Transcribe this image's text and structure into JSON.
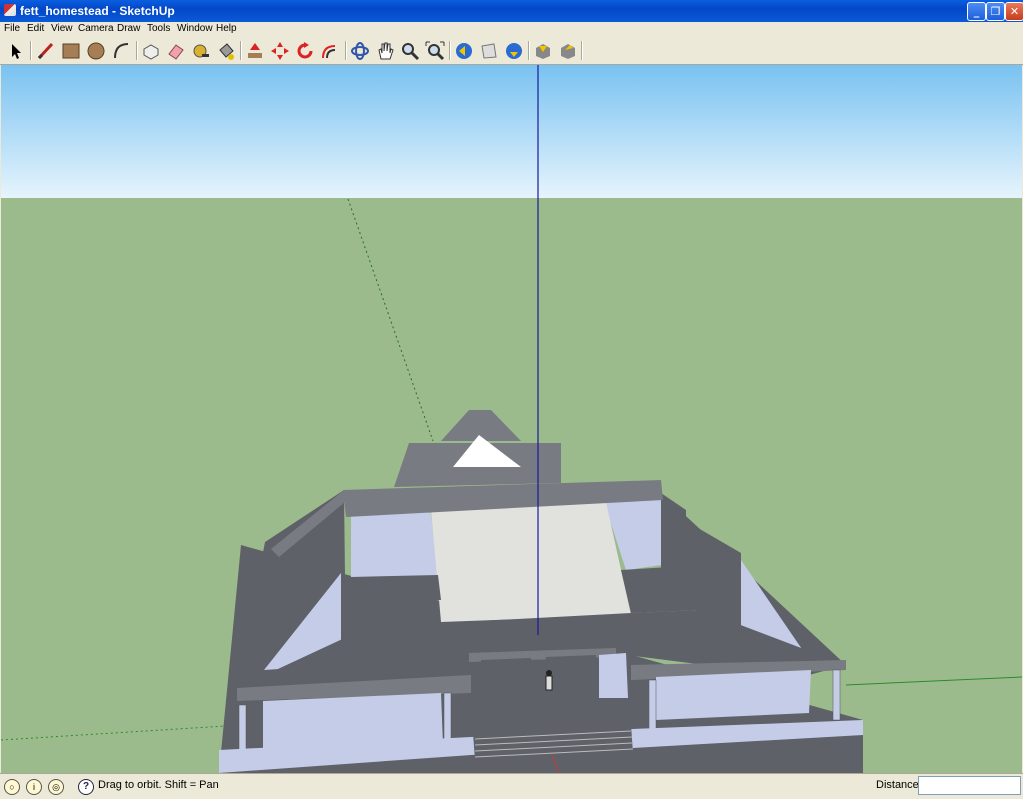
{
  "window": {
    "title": "fett_homestead - SketchUp",
    "buttons": {
      "minimize": "_",
      "maximize": "❐",
      "close": "✕"
    }
  },
  "menu": {
    "items": [
      "File",
      "Edit",
      "View",
      "Camera",
      "Draw",
      "Tools",
      "Window",
      "Help"
    ]
  },
  "toolbar": {
    "tools": [
      "select-tool-icon",
      "line-tool-icon",
      "rectangle-tool-icon",
      "circle-tool-icon",
      "arc-tool-icon",
      "make-component-icon",
      "eraser-tool-icon",
      "tape-measure-icon",
      "paint-bucket-icon",
      "push-pull-icon",
      "move-tool-icon",
      "rotate-tool-icon",
      "offset-tool-icon",
      "orbit-tool-icon",
      "pan-tool-icon",
      "zoom-tool-icon",
      "zoom-extents-icon",
      "previous-view-icon",
      "next-view-icon",
      "get-models-icon",
      "share-model-icon",
      "share-component-icon"
    ]
  },
  "colors": {
    "sky_top": "#79c2f1",
    "sky_bottom": "#e6f4fc",
    "ground": "#9cbb8d",
    "wall_light": "#c5cce7",
    "roof_dark": "#5f6168",
    "roof_mid": "#797b82",
    "axis_blue": "#1a1a9c",
    "axis_green": "#2c8a2c",
    "axis_red": "#c83a3a"
  },
  "status": {
    "text": "Drag to orbit.  Shift = Pan",
    "distance_label": "Distance",
    "distance_value": ""
  }
}
